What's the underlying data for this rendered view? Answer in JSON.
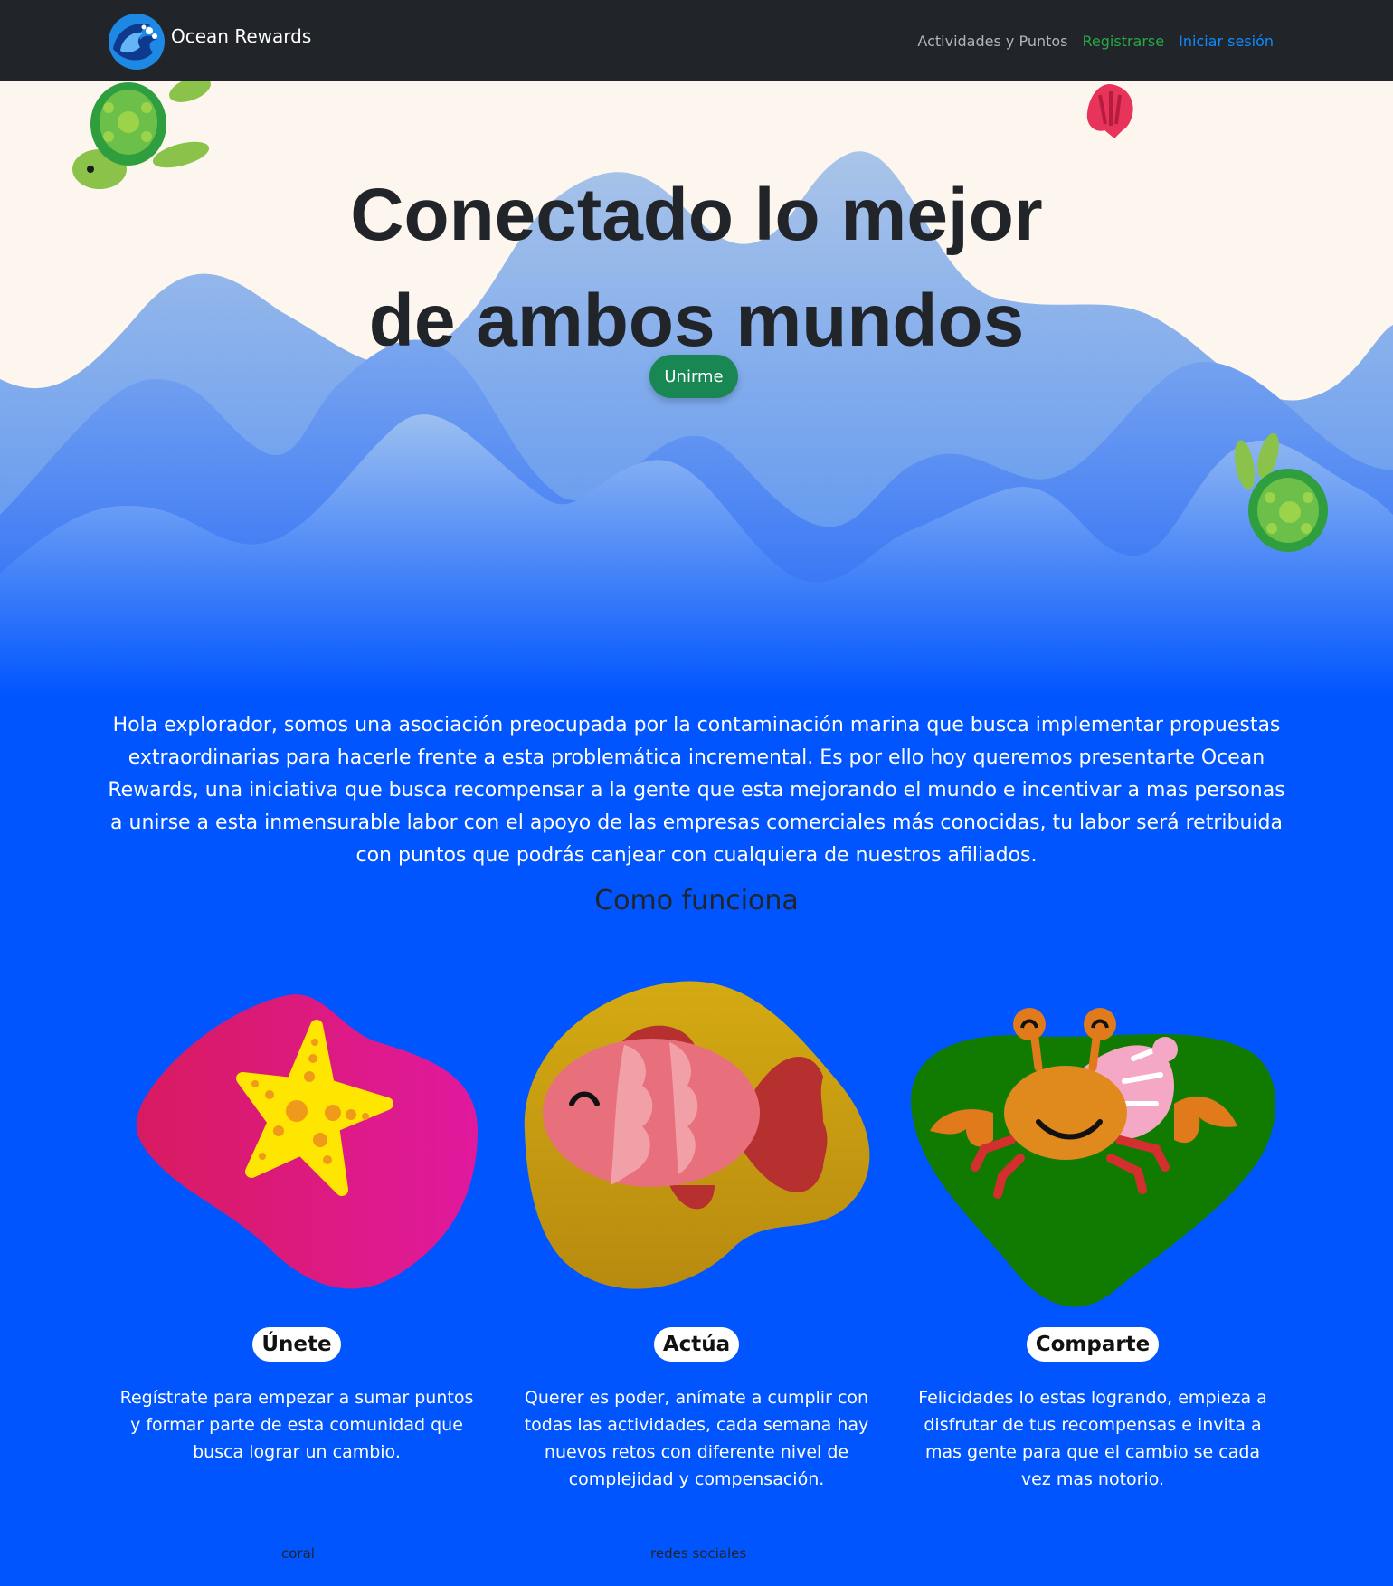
{
  "navbar": {
    "brand": "Ocean Rewards",
    "links": [
      {
        "label": "Actividades y Puntos",
        "color": "#adb5bd"
      },
      {
        "label": "Registrarse",
        "color": "#28a745"
      },
      {
        "label": "Iniciar sesión",
        "color": "#0d8bff"
      }
    ]
  },
  "hero": {
    "title_line1": "Conectado lo mejor",
    "title_line2": "de ambos mundos",
    "join_button": "Unirme",
    "colors": {
      "sand": "#fdf6ee",
      "wave_top": "#9bbce6",
      "wave_mid": "#4c8ef7",
      "ocean": "#0055ff"
    }
  },
  "intro": {
    "text": "Hola explorador, somos una asociación preocupada por la contaminación marina que busca implementar propuestas extraordinarias para hacerle frente a esta problemática incremental. Es por ello hoy queremos presentarte Ocean Rewards, una iniciativa que busca recompensar a la gente que esta mejorando el mundo e incentivar a mas personas a unirse a esta inmensurable labor con el apoyo de las empresas comerciales más conocidas, tu labor será retribuida con puntos que podrás canjear con cualquiera de nuestros afiliados."
  },
  "how_it_works": {
    "title": "Como funciona",
    "steps": [
      {
        "title": "Únete",
        "icon": "starfish-icon",
        "color": "#e0197a",
        "description": "Regístrate para empezar a sumar puntos y formar parte de esta comunidad que busca lograr un cambio."
      },
      {
        "title": "Actúa",
        "icon": "fish-icon",
        "color": "#c8a010",
        "description": "Querer es poder, anímate a cumplir con todas las actividades, cada semana hay nuevos retos con diferente nivel de complejidad y compensación."
      },
      {
        "title": "Comparte",
        "icon": "crab-icon",
        "color": "#117a00",
        "description": "Felicidades lo estas logrando, empieza a disfrutar de tus recompensas e invita a mas gente para que el cambio se cada vez mas notorio."
      }
    ]
  },
  "footer": {
    "links": [
      "coral",
      "redes sociales"
    ]
  }
}
